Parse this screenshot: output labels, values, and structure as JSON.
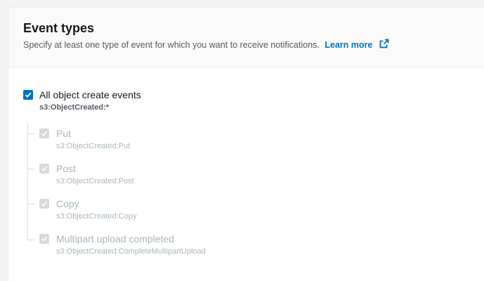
{
  "section": {
    "title": "Event types",
    "description": "Specify at least one type of event for which you want to receive notifications.",
    "learn_more": "Learn more"
  },
  "options": {
    "parent": {
      "label": "All object create events",
      "event": "s3:ObjectCreated:*",
      "checked": true
    },
    "children": [
      {
        "label": "Put",
        "event": "s3:ObjectCreated:Put",
        "checked": true,
        "disabled": true
      },
      {
        "label": "Post",
        "event": "s3:ObjectCreated:Post",
        "checked": true,
        "disabled": true
      },
      {
        "label": "Copy",
        "event": "s3:ObjectCreated:Copy",
        "checked": true,
        "disabled": true
      },
      {
        "label": "Multipart upload completed",
        "event": "s3:ObjectCreated:CompleteMultipartUpload",
        "checked": true,
        "disabled": true
      }
    ]
  },
  "colors": {
    "accent": "#0073bb",
    "disabled": "#aab7b8"
  },
  "icons": {
    "learn_more": "external-link-icon",
    "checkbox": "checkmark-icon"
  }
}
